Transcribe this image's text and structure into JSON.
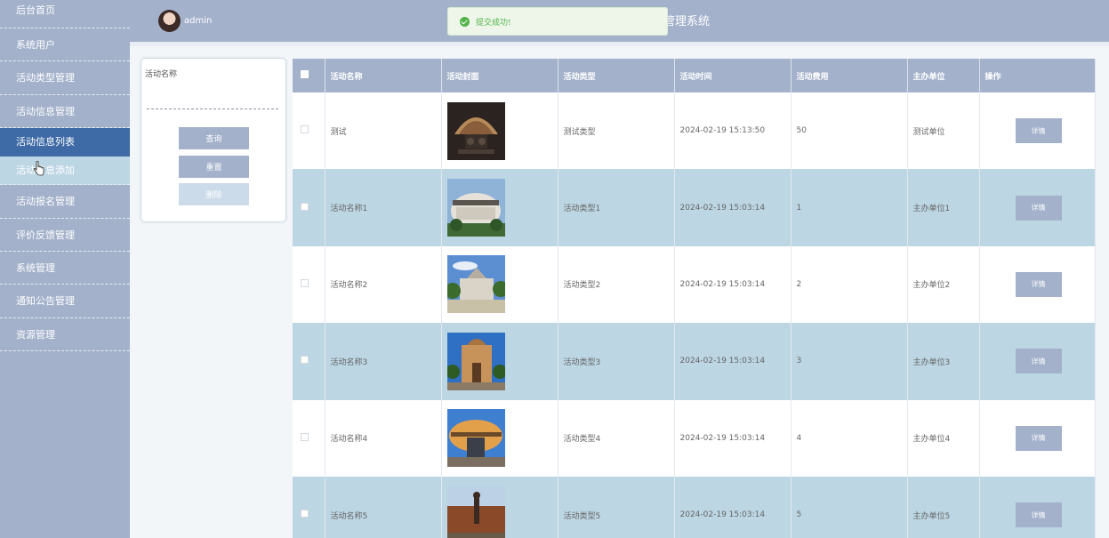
{
  "sidebar": {
    "items": [
      {
        "label": "后台首页"
      },
      {
        "label": "系统用户"
      },
      {
        "label": "活动类型管理"
      },
      {
        "label": "活动信息管理"
      },
      {
        "label": "活动信息列表"
      },
      {
        "label": "活动信息添加"
      },
      {
        "label": "活动报名管理"
      },
      {
        "label": "评价反馈管理"
      },
      {
        "label": "系统管理"
      },
      {
        "label": "通知公告管理"
      },
      {
        "label": "资源管理"
      }
    ]
  },
  "header": {
    "username": "admin",
    "system_title": "管理系统"
  },
  "toast": {
    "message": "提交成功!"
  },
  "search": {
    "label": "活动名称",
    "value": "",
    "query_button": "查询",
    "reset_button": "重置",
    "delete_button": "删除"
  },
  "table": {
    "headers": [
      "活动名称",
      "活动封面",
      "活动类型",
      "活动时间",
      "活动费用",
      "主办单位",
      "操作"
    ],
    "rows": [
      {
        "name": "测试",
        "type": "测试类型",
        "time": "2024-02-19 15:13:50",
        "fee": "50",
        "organizer": "测试单位",
        "action": "详情"
      },
      {
        "name": "活动名称1",
        "type": "活动类型1",
        "time": "2024-02-19 15:03:14",
        "fee": "1",
        "organizer": "主办单位1",
        "action": "详情"
      },
      {
        "name": "活动名称2",
        "type": "活动类型2",
        "time": "2024-02-19 15:03:14",
        "fee": "2",
        "organizer": "主办单位2",
        "action": "详情"
      },
      {
        "name": "活动名称3",
        "type": "活动类型3",
        "time": "2024-02-19 15:03:14",
        "fee": "3",
        "organizer": "主办单位3",
        "action": "详情"
      },
      {
        "name": "活动名称4",
        "type": "活动类型4",
        "time": "2024-02-19 15:03:14",
        "fee": "4",
        "organizer": "主办单位4",
        "action": "详情"
      },
      {
        "name": "活动名称5",
        "type": "活动类型5",
        "time": "2024-02-19 15:03:14",
        "fee": "5",
        "organizer": "主办单位5",
        "action": "详情"
      }
    ]
  },
  "colors": {
    "sidebar_bg": "#a3b1cb",
    "active_item": "#3e6aa6",
    "alt_row": "#bcd6e3",
    "success": "#52b34a"
  }
}
